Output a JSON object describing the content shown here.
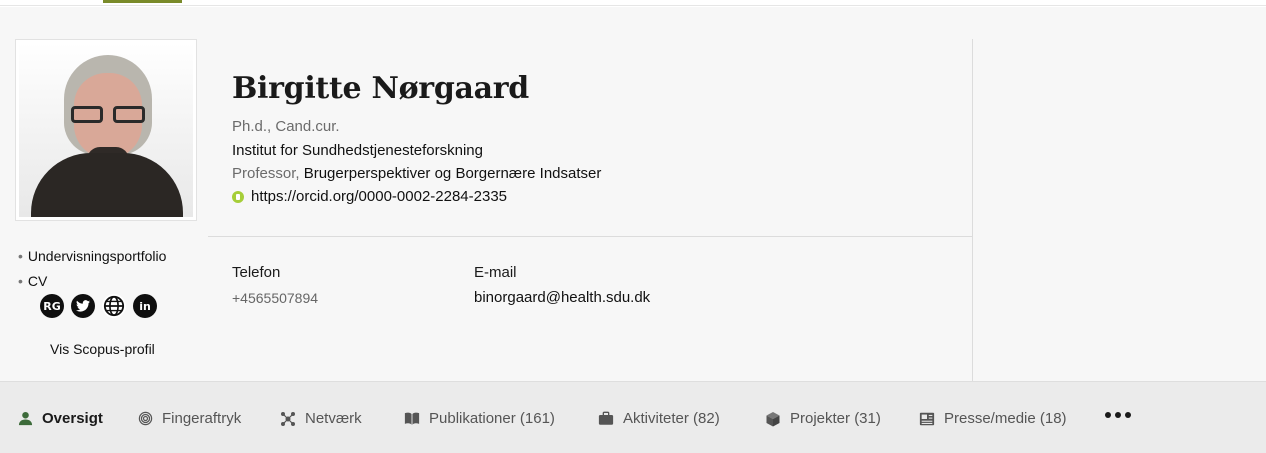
{
  "profile": {
    "name": "Birgitte Nørgaard",
    "degree": "Ph.d., Cand.cur.",
    "institute": "Institut for Sundhedstjenesteforskning",
    "role": "Professor,",
    "department": "Brugerperspektiver og Borgernære Indsatser",
    "orcid": "https://orcid.org/0000-0002-2284-2335"
  },
  "side_links": {
    "portfolio": "Undervisningsportfolio",
    "cv": "CV",
    "bullet": "•",
    "scopus": "Vis Scopus-profil"
  },
  "socials": [
    {
      "icon": "researchgate-icon",
      "label": "RG"
    },
    {
      "icon": "twitter-icon"
    },
    {
      "icon": "globe-icon"
    },
    {
      "icon": "linkedin-icon",
      "label": "in"
    }
  ],
  "contact": {
    "phone_label": "Telefon",
    "phone": "+4565507894",
    "email_label": "E-mail",
    "email": "binorgaard@health.sdu.dk"
  },
  "tabs": [
    {
      "label": "Oversigt",
      "icon": "person-icon",
      "active": true
    },
    {
      "label": "Fingeraftryk",
      "icon": "fingerprint-icon"
    },
    {
      "label": "Netværk",
      "icon": "network-icon"
    },
    {
      "label": "Publikationer (161)",
      "icon": "book-icon"
    },
    {
      "label": "Aktiviteter (82)",
      "icon": "briefcase-icon"
    },
    {
      "label": "Projekter (31)",
      "icon": "cube-icon"
    },
    {
      "label": "Presse/medie (18)",
      "icon": "newspaper-icon"
    }
  ],
  "colors": {
    "accent_green": "#3d6b3a",
    "orcid_green": "#a6ce39",
    "top_tab": "#7a8b2a"
  }
}
